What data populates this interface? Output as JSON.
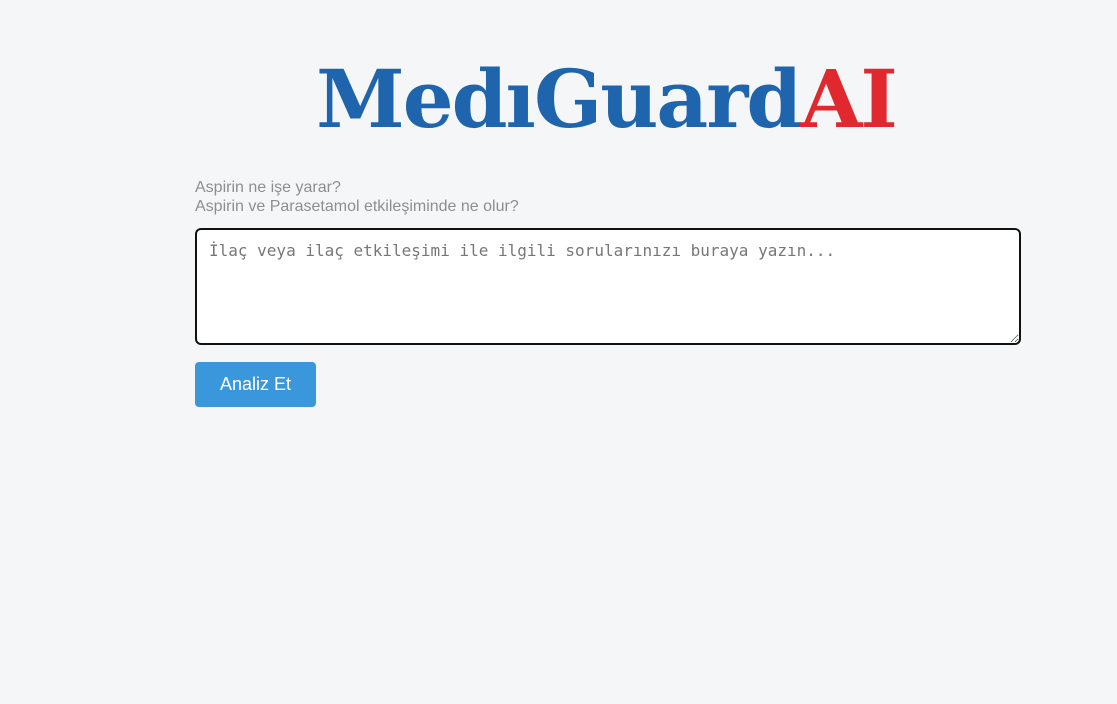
{
  "logo": {
    "main": "MedıGuard",
    "accent": "AI"
  },
  "examples": [
    "Aspirin ne işe yarar?",
    "Aspirin ve Parasetamol etkileşiminde ne olur?"
  ],
  "question_input": {
    "value": "",
    "placeholder": "İlaç veya ilaç etkileşimi ile ilgili sorularınızı buraya yazın..."
  },
  "analyze_button": {
    "label": "Analiz Et"
  },
  "colors": {
    "brand_blue": "#1f65ad",
    "brand_red": "#e0282e",
    "button_blue": "#3a97dc",
    "background": "#f5f6f8"
  }
}
